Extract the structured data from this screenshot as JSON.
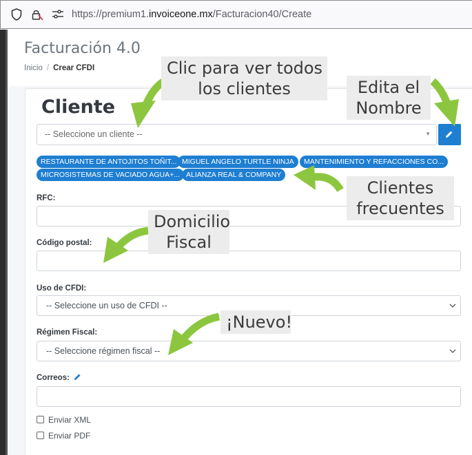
{
  "browser": {
    "url_prefix": "https://premium1.",
    "url_domain": "invoiceone.mx",
    "url_path": "/Facturacion40/Create"
  },
  "header": {
    "app_title": "Facturación 4.0",
    "breadcrumb": {
      "home": "Inicio",
      "separator": "/",
      "current": "Crear CFDI"
    }
  },
  "form": {
    "section_title": "Cliente",
    "cliente_select": {
      "value": "-- Seleccione un cliente --"
    },
    "frequent_clients": [
      "RESTAURANTE DE ANTOJITOS TOÑIT...",
      "MIGUEL ANGELO TURTLE NINJA",
      "MANTENIMIENTO Y REFACCIONES CO...",
      "MICROSISTEMAS DE VACIADO AGUA+...",
      "ALIANZA REAL & COMPANY"
    ],
    "rfc_label": "RFC:",
    "cp_label": "Código postal:",
    "uso_cfdi_label": "Uso de CFDI:",
    "uso_cfdi_value": "-- Seleccione un uso de CFDI --",
    "regimen_label": "Régimen Fiscal:",
    "regimen_value": "-- Seleccione régimen fiscal --",
    "correos_label": "Correos:",
    "enviar_xml": "Enviar XML",
    "enviar_pdf": "Enviar PDF"
  },
  "callouts": {
    "ver_clientes_l1": "Clic para ver todos",
    "ver_clientes_l2": "los clientes",
    "edita_l1": "Edita el",
    "edita_l2": "Nombre",
    "frecuentes_l1": "Clientes",
    "frecuentes_l2": "frecuentes",
    "domicilio_l1": "Domicilio",
    "domicilio_l2": "Fiscal",
    "nuevo": "¡Nuevo!"
  },
  "colors": {
    "primary": "#1e7ed1",
    "arrow_green": "#8cc63f",
    "callout_bg": "#ececec"
  },
  "icons": [
    "shield-icon",
    "lock-icon",
    "permissions-icon",
    "pencil-icon",
    "chevron-down-icon"
  ]
}
